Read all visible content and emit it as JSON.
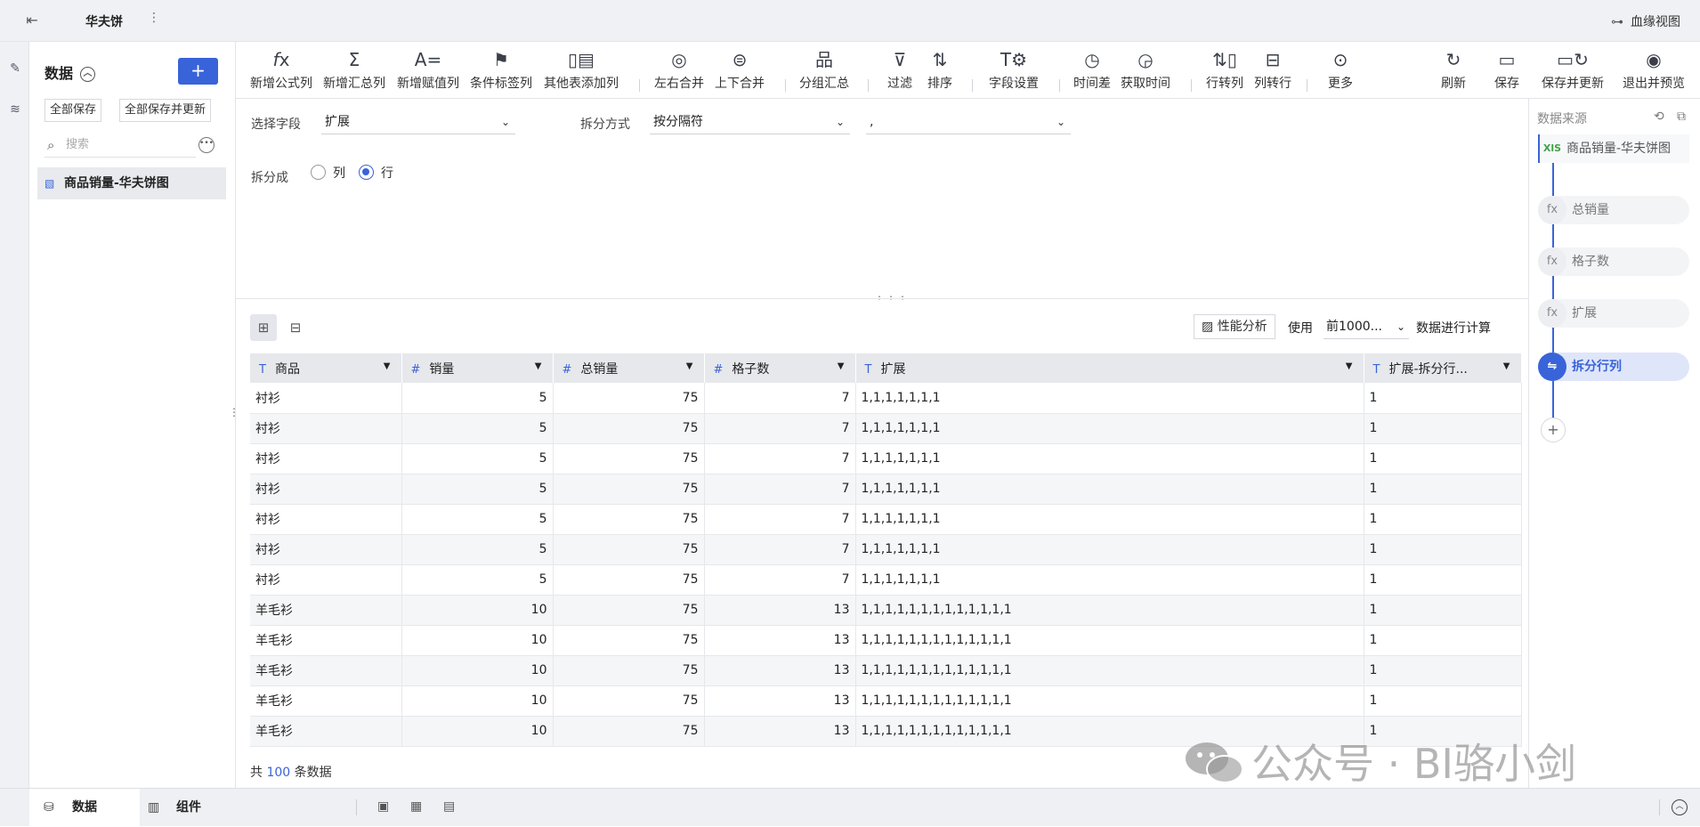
{
  "topbar": {
    "title": "华夫饼",
    "more": "⋮",
    "lineage": "血缘视图"
  },
  "datapanel": {
    "title": "数据",
    "add": "+",
    "save_all": "全部保存",
    "save_all_update": "全部保存并更新",
    "search_placeholder": "搜索",
    "item": "商品销量-华夫饼图"
  },
  "toolbar": {
    "items": [
      {
        "label": "新增公式列",
        "icon": "f(x)"
      },
      {
        "label": "新增汇总列",
        "icon": "Σ"
      },
      {
        "label": "新增赋值列",
        "icon": "A="
      },
      {
        "label": "条件标签列",
        "icon": "flag"
      },
      {
        "label": "其他表添加列",
        "icon": "table-add"
      },
      {
        "label": "左右合并",
        "icon": "venn-lr"
      },
      {
        "label": "上下合并",
        "icon": "venn-ud"
      },
      {
        "label": "分组汇总",
        "icon": "group"
      },
      {
        "label": "过滤",
        "icon": "filter"
      },
      {
        "label": "排序",
        "icon": "sort"
      },
      {
        "label": "字段设置",
        "icon": "field-set"
      },
      {
        "label": "时间差",
        "icon": "clock"
      },
      {
        "label": "获取时间",
        "icon": "clock-get"
      },
      {
        "label": "行转列",
        "icon": "row-col"
      },
      {
        "label": "列转行",
        "icon": "col-row"
      },
      {
        "label": "更多",
        "icon": "more"
      },
      {
        "label": "刷新",
        "icon": "refresh"
      },
      {
        "label": "保存",
        "icon": "save"
      },
      {
        "label": "保存并更新",
        "icon": "save-update"
      },
      {
        "label": "退出并预览",
        "icon": "exit-preview"
      }
    ]
  },
  "config": {
    "field_label": "选择字段",
    "field_value": "扩展",
    "method_label": "拆分方式",
    "method_value": "按分隔符",
    "separator_value": ",",
    "split_into_label": "拆分成",
    "option_col": "列",
    "option_row": "行",
    "selected": "行"
  },
  "preview": {
    "perf_button": "性能分析",
    "use_label": "使用",
    "use_value": "前1000...",
    "use_suffix": "数据进行计算",
    "total_prefix": "共",
    "total_count": "100",
    "total_suffix": "条数据",
    "columns": [
      {
        "name": "商品",
        "type": "T"
      },
      {
        "name": "销量",
        "type": "#"
      },
      {
        "name": "总销量",
        "type": "#"
      },
      {
        "name": "格子数",
        "type": "#"
      },
      {
        "name": "扩展",
        "type": "T"
      },
      {
        "name": "扩展-拆分行...",
        "type": "T"
      }
    ],
    "rows": [
      [
        "衬衫",
        "5",
        "75",
        "7",
        "1,1,1,1,1,1,1",
        "1"
      ],
      [
        "衬衫",
        "5",
        "75",
        "7",
        "1,1,1,1,1,1,1",
        "1"
      ],
      [
        "衬衫",
        "5",
        "75",
        "7",
        "1,1,1,1,1,1,1",
        "1"
      ],
      [
        "衬衫",
        "5",
        "75",
        "7",
        "1,1,1,1,1,1,1",
        "1"
      ],
      [
        "衬衫",
        "5",
        "75",
        "7",
        "1,1,1,1,1,1,1",
        "1"
      ],
      [
        "衬衫",
        "5",
        "75",
        "7",
        "1,1,1,1,1,1,1",
        "1"
      ],
      [
        "衬衫",
        "5",
        "75",
        "7",
        "1,1,1,1,1,1,1",
        "1"
      ],
      [
        "羊毛衫",
        "10",
        "75",
        "13",
        "1,1,1,1,1,1,1,1,1,1,1,1,1",
        "1"
      ],
      [
        "羊毛衫",
        "10",
        "75",
        "13",
        "1,1,1,1,1,1,1,1,1,1,1,1,1",
        "1"
      ],
      [
        "羊毛衫",
        "10",
        "75",
        "13",
        "1,1,1,1,1,1,1,1,1,1,1,1,1",
        "1"
      ],
      [
        "羊毛衫",
        "10",
        "75",
        "13",
        "1,1,1,1,1,1,1,1,1,1,1,1,1",
        "1"
      ],
      [
        "羊毛衫",
        "10",
        "75",
        "13",
        "1,1,1,1,1,1,1,1,1,1,1,1,1",
        "1"
      ]
    ]
  },
  "flow": {
    "title": "数据来源",
    "nodes": [
      {
        "label": "商品销量-华夫饼图",
        "icon": "XlS"
      },
      {
        "label": "总销量",
        "icon": "fx"
      },
      {
        "label": "格子数",
        "icon": "fx"
      },
      {
        "label": "扩展",
        "icon": "fx"
      },
      {
        "label": "拆分行列",
        "icon": "split"
      }
    ]
  },
  "bottombar": {
    "tab_data": "数据",
    "tab_component": "组件"
  },
  "watermark": "公众号 · BI骆小剑",
  "colors": {
    "accent": "#3963d8",
    "source_icon": "#43a047"
  }
}
